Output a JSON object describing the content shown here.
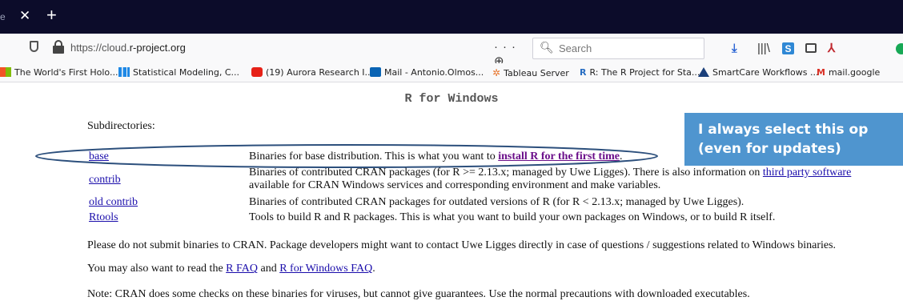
{
  "browser": {
    "tab_fragment": "e",
    "tab_close_icon": "close-icon",
    "new_tab_icon": "plus-icon",
    "url_scheme": "https://cloud.",
    "url_host": "r-project.org",
    "url_actions": "··· ⊕ ☆",
    "search_placeholder": "Search",
    "toolbar_s_label": "S"
  },
  "bookmarks": [
    {
      "label": "The World's First Holo...",
      "icon": "windows-icon"
    },
    {
      "label": "Statistical Modeling, C...",
      "icon": "bar-chart-icon"
    },
    {
      "label": "(19) Aurora Research I...",
      "icon": "youtube-icon"
    },
    {
      "label": "Mail - Antonio.Olmos...",
      "icon": "outlook-icon"
    },
    {
      "label": "Tableau Server",
      "icon": "tableau-icon"
    },
    {
      "label": "R: The R Project for Sta...",
      "icon": "r-logo-icon"
    },
    {
      "label": "SmartCare Workflows ...",
      "icon": "smartcare-icon"
    },
    {
      "label": "mail.google",
      "icon": "gmail-icon"
    }
  ],
  "page": {
    "title": "R for Windows",
    "subdirectories_label": "Subdirectories:",
    "rows": [
      {
        "link": "base",
        "desc_before": "Binaries for base distribution. This is what you want to ",
        "desc_link": "install R for the first time",
        "desc_after": "."
      },
      {
        "link": "contrib",
        "line1": "Binaries of contributed CRAN packages (for R >= 2.13.x; managed by Uwe Ligges). There is also information on ",
        "line1_link": "third party software",
        "line2": "available for CRAN Windows services and corresponding environment and make variables."
      },
      {
        "link": "old contrib",
        "desc": "Binaries of contributed CRAN packages for outdated versions of R (for R < 2.13.x; managed by Uwe Ligges)."
      },
      {
        "link": "Rtools",
        "desc": "Tools to build R and R packages. This is what you want to build your own packages on Windows, or to build R itself."
      }
    ],
    "para1": "Please do not submit binaries to CRAN. Package developers might want to contact Uwe Ligges directly in case of questions / suggestions related to Windows binaries.",
    "para2_before": "You may also want to read the ",
    "para2_link1": "R FAQ",
    "para2_mid": " and ",
    "para2_link2": "R for Windows FAQ",
    "para2_after": ".",
    "para3": "Note: CRAN does some checks on these binaries for viruses, but cannot give guarantees. Use the normal precautions with downloaded executables."
  },
  "callout": {
    "line1": "I always select this op",
    "line2": "(even for updates)",
    "bg_color": "#4f95cf"
  }
}
